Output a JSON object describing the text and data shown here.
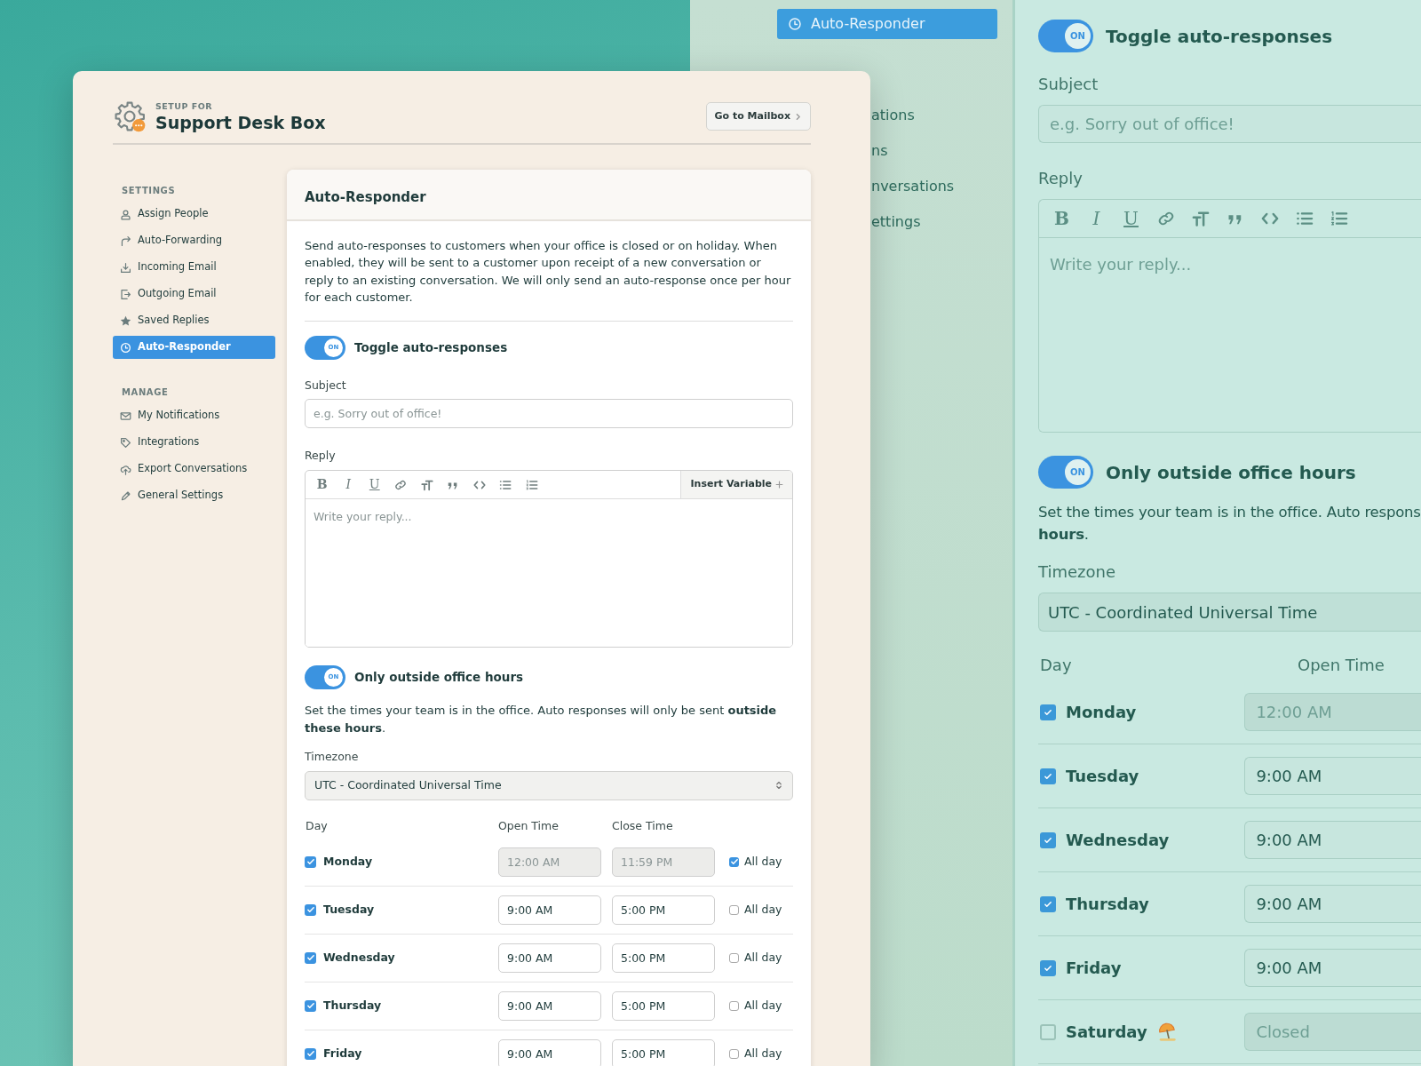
{
  "main_window": {
    "setup_label": "SETUP FOR",
    "title": "Support Desk Box",
    "mailbox_button": "Go to Mailbox",
    "sidebar": [
      {
        "heading": "SETTINGS",
        "items": [
          {
            "label": "Assign People",
            "selected": false
          },
          {
            "label": "Auto-Forwarding",
            "selected": false
          },
          {
            "label": "Incoming Email",
            "selected": false
          },
          {
            "label": "Outgoing Email",
            "selected": false
          },
          {
            "label": "Saved Replies",
            "selected": false
          },
          {
            "label": "Auto-Responder",
            "selected": true
          }
        ]
      },
      {
        "heading": "MANAGE",
        "items": [
          {
            "label": "My Notifications",
            "selected": false
          },
          {
            "label": "Integrations",
            "selected": false
          },
          {
            "label": "Export Conversations",
            "selected": false
          },
          {
            "label": "General Settings",
            "selected": false
          }
        ]
      }
    ],
    "panel": {
      "title": "Auto-Responder",
      "description": "Send auto-responses to customers when your office is closed or on holiday. When enabled, they will be sent to a customer upon receipt of a new conversation or reply to an existing conversation. We will only send an auto-response once per hour for each customer.",
      "toggle": {
        "label": "Toggle auto-responses",
        "on": true,
        "state_text": "ON"
      },
      "subject": {
        "label": "Subject",
        "placeholder": "e.g. Sorry out of office!"
      },
      "reply": {
        "label": "Reply",
        "placeholder": "Write your reply...",
        "insert_variable": "Insert Variable",
        "toolbar": [
          {
            "kind": "bold",
            "label": "B"
          },
          {
            "kind": "italic",
            "label": "I"
          },
          {
            "kind": "underline",
            "label": "U"
          },
          {
            "kind": "link"
          },
          {
            "kind": "size"
          },
          {
            "kind": "quote"
          },
          {
            "kind": "code"
          },
          {
            "kind": "bullets"
          },
          {
            "kind": "numbers"
          }
        ]
      },
      "hours_toggle": {
        "label": "Only outside office hours",
        "on": true,
        "state_text": "ON"
      },
      "hours_text": "Set the times your team is in the office. Auto responses will only be sent **outside these hours**.",
      "timezone": {
        "label": "Timezone",
        "value": "UTC - Coordinated Universal Time"
      },
      "columns": [
        "Day",
        "Open Time",
        "Close Time"
      ],
      "days": [
        {
          "name": "Monday",
          "checked": true,
          "open": "12:00 AM",
          "close": "11:59 PM",
          "disabled": true,
          "all_day": true,
          "all_day_label": "All day"
        },
        {
          "name": "Tuesday",
          "checked": true,
          "open": "9:00 AM",
          "close": "5:00 PM",
          "disabled": false,
          "all_day": false,
          "all_day_label": "All day"
        },
        {
          "name": "Wednesday",
          "checked": true,
          "open": "9:00 AM",
          "close": "5:00 PM",
          "disabled": false,
          "all_day": false,
          "all_day_label": "All day"
        },
        {
          "name": "Thursday",
          "checked": true,
          "open": "9:00 AM",
          "close": "5:00 PM",
          "disabled": false,
          "all_day": false,
          "all_day_label": "All day"
        },
        {
          "name": "Friday",
          "checked": true,
          "open": "9:00 AM",
          "close": "5:00 PM",
          "disabled": false,
          "all_day": false,
          "all_day_label": "All day"
        }
      ]
    }
  },
  "zoom_sidebar": {
    "items": [
      {
        "label": "Auto-Responder",
        "selected": true
      },
      {
        "label": "ations",
        "selected": false
      },
      {
        "label": "ns",
        "selected": false
      },
      {
        "label": "nversations",
        "selected": false
      },
      {
        "label": "ettings",
        "selected": false
      }
    ]
  },
  "zoom_form": {
    "toggle": {
      "label": "Toggle auto-responses",
      "on": true,
      "state_text": "ON"
    },
    "subject": {
      "label": "Subject",
      "placeholder": "e.g. Sorry out of office!"
    },
    "reply": {
      "label": "Reply",
      "placeholder": "Write your reply...",
      "toolbar": [
        {
          "kind": "bold",
          "label": "B"
        },
        {
          "kind": "italic",
          "label": "I"
        },
        {
          "kind": "underline",
          "label": "U"
        },
        {
          "kind": "link"
        },
        {
          "kind": "size"
        },
        {
          "kind": "quote"
        },
        {
          "kind": "code"
        },
        {
          "kind": "bullets"
        },
        {
          "kind": "numbers"
        }
      ]
    },
    "hours_toggle": {
      "label": "Only outside office hours",
      "on": true,
      "state_text": "ON"
    },
    "hours_text": [
      "Set the times your team is in the office. Auto respons",
      "**hours**."
    ],
    "timezone": {
      "label": "Timezone",
      "value": "UTC - Coordinated Universal Time"
    },
    "columns": [
      "Day",
      "Open Time"
    ],
    "days": [
      {
        "name": "Monday",
        "checked": true,
        "open": "12:00 AM",
        "disabled": true
      },
      {
        "name": "Tuesday",
        "checked": true,
        "open": "9:00 AM",
        "disabled": false
      },
      {
        "name": "Wednesday",
        "checked": true,
        "open": "9:00 AM",
        "disabled": false
      },
      {
        "name": "Thursday",
        "checked": true,
        "open": "9:00 AM",
        "disabled": false
      },
      {
        "name": "Friday",
        "checked": true,
        "open": "9:00 AM",
        "disabled": false
      },
      {
        "name": "Saturday",
        "checked": false,
        "open": "Closed",
        "disabled": true,
        "holiday": true
      }
    ]
  }
}
